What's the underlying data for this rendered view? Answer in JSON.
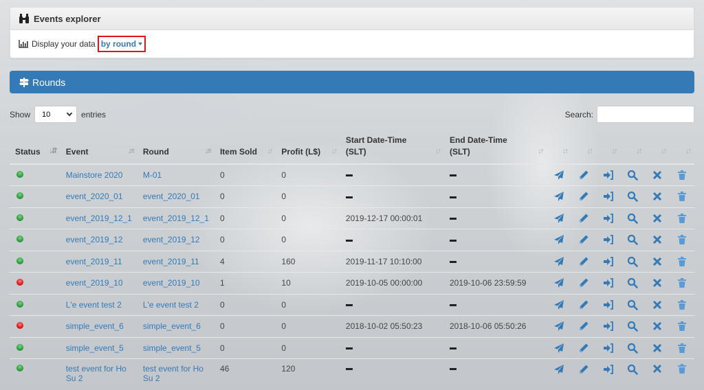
{
  "header": {
    "title": "Events explorer",
    "display_label": "Display your data",
    "display_mode": "by round"
  },
  "rounds_panel": {
    "title": "Rounds"
  },
  "table_controls": {
    "show_label": "Show",
    "entries_value": "10",
    "entries_label": "entries",
    "search_label": "Search:",
    "search_value": ""
  },
  "columns": [
    {
      "label": "Status"
    },
    {
      "label": "Event"
    },
    {
      "label": "Round"
    },
    {
      "label": "Item Sold"
    },
    {
      "label": "Profit (L$)"
    },
    {
      "label": "Start Date-Time (SLT)"
    },
    {
      "label": "End Date-Time (SLT)"
    }
  ],
  "action_icons": [
    "send-icon",
    "edit-icon",
    "enter-icon",
    "search-icon",
    "close-icon",
    "trash-icon"
  ],
  "status_colors": {
    "active": "#2ea043",
    "inactive": "#e01b1b"
  },
  "rows": [
    {
      "status": "green",
      "event": "Mainstore 2020",
      "round": "M-01",
      "item_sold": "0",
      "profit": "0",
      "start": "",
      "end": ""
    },
    {
      "status": "green",
      "event": "event_2020_01",
      "round": "event_2020_01",
      "item_sold": "0",
      "profit": "0",
      "start": "",
      "end": ""
    },
    {
      "status": "green",
      "event": "event_2019_12_1",
      "round": "event_2019_12_1",
      "item_sold": "0",
      "profit": "0",
      "start": "2019-12-17 00:00:01",
      "end": ""
    },
    {
      "status": "green",
      "event": "event_2019_12",
      "round": "event_2019_12",
      "item_sold": "0",
      "profit": "0",
      "start": "",
      "end": ""
    },
    {
      "status": "green",
      "event": "event_2019_11",
      "round": "event_2019_11",
      "item_sold": "4",
      "profit": "160",
      "start": "2019-11-17 10:10:00",
      "end": ""
    },
    {
      "status": "red",
      "event": "event_2019_10",
      "round": "event_2019_10",
      "item_sold": "1",
      "profit": "10",
      "start": "2019-10-05 00:00:00",
      "end": "2019-10-06 23:59:59"
    },
    {
      "status": "green",
      "event": "L'e event test 2",
      "round": "L'e event test 2",
      "item_sold": "0",
      "profit": "0",
      "start": "",
      "end": ""
    },
    {
      "status": "red",
      "event": "simple_event_6",
      "round": "simple_event_6",
      "item_sold": "0",
      "profit": "0",
      "start": "2018-10-02 05:50:23",
      "end": "2018-10-06 05:50:26"
    },
    {
      "status": "green",
      "event": "simple_event_5",
      "round": "simple_event_5",
      "item_sold": "0",
      "profit": "0",
      "start": "",
      "end": ""
    },
    {
      "status": "green",
      "event": "test event for Ho Su 2",
      "round": "test event for Ho Su 2",
      "item_sold": "46",
      "profit": "120",
      "start": "",
      "end": ""
    }
  ]
}
